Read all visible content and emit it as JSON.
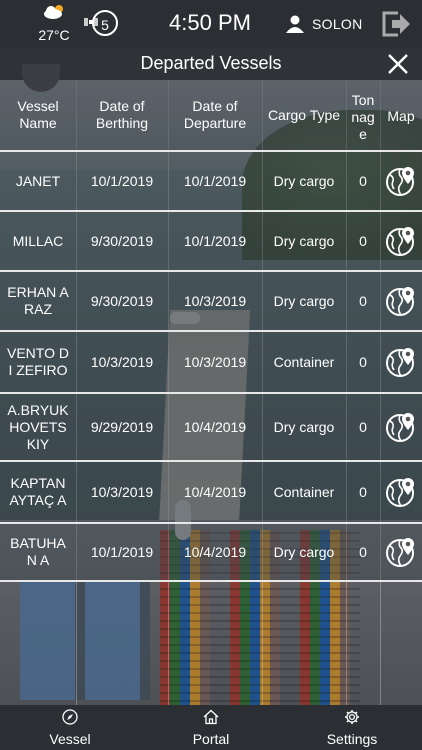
{
  "status": {
    "temperature": "27°C",
    "satellite_count": "5",
    "time": "4:50 PM",
    "user": "SOLON",
    "weather_icon": "partly-cloudy-icon"
  },
  "header": {
    "title": "Departed Vessels"
  },
  "table": {
    "columns": [
      "Vessel Name",
      "Date of Berthing",
      "Date of Departure",
      "Cargo Type",
      "Tonnage",
      "Map"
    ],
    "rows": [
      {
        "name": "JANET",
        "berthing": "10/1/2019",
        "departure": "10/1/2019",
        "cargo": "Dry cargo",
        "tonnage": "0"
      },
      {
        "name": "MILLAC",
        "berthing": "9/30/2019",
        "departure": "10/1/2019",
        "cargo": "Dry cargo",
        "tonnage": "0"
      },
      {
        "name": "ERHAN ARAZ",
        "berthing": "9/30/2019",
        "departure": "10/3/2019",
        "cargo": "Dry cargo",
        "tonnage": "0"
      },
      {
        "name": "VENTO DI ZEFIRO",
        "berthing": "10/3/2019",
        "departure": "10/3/2019",
        "cargo": "Container",
        "tonnage": "0"
      },
      {
        "name": "A.BRYUKHOVETSKIY",
        "berthing": "9/29/2019",
        "departure": "10/4/2019",
        "cargo": "Dry cargo",
        "tonnage": "0"
      },
      {
        "name": "KAPTAN AYTAÇ A",
        "berthing": "10/3/2019",
        "departure": "10/4/2019",
        "cargo": "Container",
        "tonnage": "0"
      },
      {
        "name": "BATUHAN A",
        "berthing": "10/1/2019",
        "departure": "10/4/2019",
        "cargo": "Dry cargo",
        "tonnage": "0"
      }
    ]
  },
  "nav": {
    "vessel": "Vessel",
    "portal": "Portal",
    "settings": "Settings"
  },
  "colors": {
    "bar": "#2b2e33",
    "divider": "#e8e8e8"
  }
}
